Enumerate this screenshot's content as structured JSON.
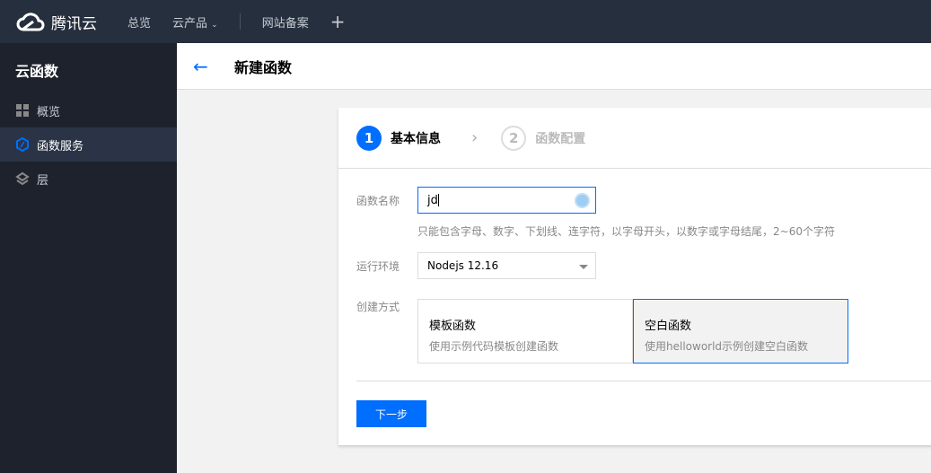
{
  "topbar": {
    "brand": "腾讯云",
    "nav": [
      "总览",
      "云产品",
      "网站备案"
    ],
    "add": "+"
  },
  "sidebar": {
    "title": "云函数",
    "items": [
      {
        "label": "概览",
        "icon": "grid-icon"
      },
      {
        "label": "函数服务",
        "icon": "function-hexagon-icon",
        "active": true
      },
      {
        "label": "层",
        "icon": "layers-icon"
      }
    ]
  },
  "header": {
    "back": "←",
    "title": "新建函数"
  },
  "steps": [
    {
      "num": "1",
      "label": "基本信息",
      "active": true
    },
    {
      "num": "2",
      "label": "函数配置"
    }
  ],
  "form": {
    "name_label": "函数名称",
    "name_value": "jd",
    "name_hint": "只能包含字母、数字、下划线、连字符，以字母开头，以数字或字母结尾，2~60个字符",
    "runtime_label": "运行环境",
    "runtime_value": "Nodejs 12.16",
    "method_label": "创建方式",
    "methods": [
      {
        "title": "模板函数",
        "desc": "使用示例代码模板创建函数"
      },
      {
        "title": "空白函数",
        "desc": "使用helloworld示例创建空白函数",
        "selected": true
      }
    ]
  },
  "next_button": "下一步",
  "colors": {
    "accent": "#006eff",
    "topbar": "#262f3e",
    "sidebar": "#1e222d"
  }
}
